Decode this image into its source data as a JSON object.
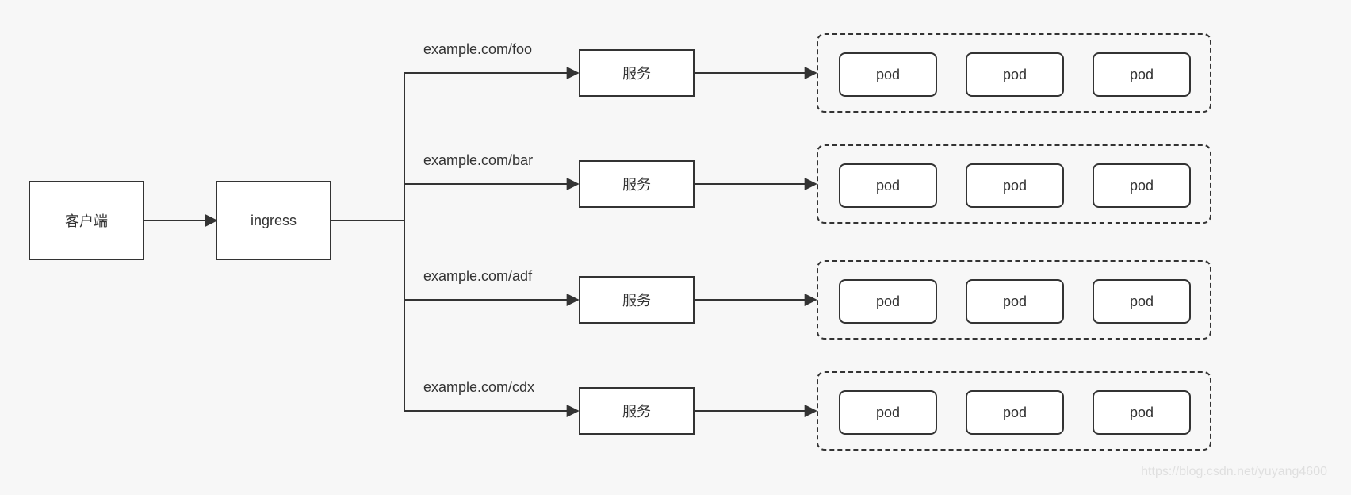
{
  "client": {
    "label": "客户端"
  },
  "ingress": {
    "label": "ingress"
  },
  "routes": [
    {
      "path_label": "example.com/foo",
      "service_label": "服务",
      "pods": [
        "pod",
        "pod",
        "pod"
      ]
    },
    {
      "path_label": "example.com/bar",
      "service_label": "服务",
      "pods": [
        "pod",
        "pod",
        "pod"
      ]
    },
    {
      "path_label": "example.com/adf",
      "service_label": "服务",
      "pods": [
        "pod",
        "pod",
        "pod"
      ]
    },
    {
      "path_label": "example.com/cdx",
      "service_label": "服务",
      "pods": [
        "pod",
        "pod",
        "pod"
      ]
    }
  ],
  "watermark": "https://blog.csdn.net/yuyang4600"
}
